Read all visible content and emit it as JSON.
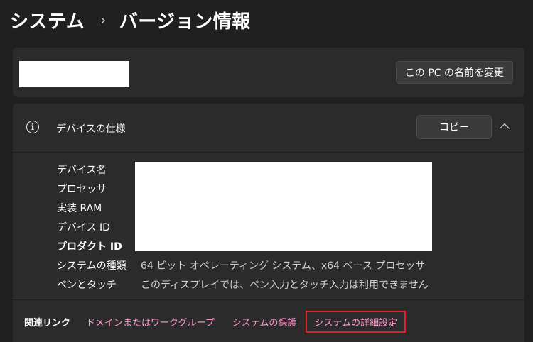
{
  "breadcrumb": {
    "parent": "システム",
    "separator": "›",
    "current": "バージョン情報"
  },
  "name_card": {
    "rename_button": "この PC の名前を変更"
  },
  "device_spec": {
    "title": "デバイスの仕様",
    "copy_button": "コピー",
    "rows": [
      {
        "label": "デバイス名",
        "value": ""
      },
      {
        "label": "プロセッサ",
        "value": ""
      },
      {
        "label": "実装 RAM",
        "value": ""
      },
      {
        "label": "デバイス ID",
        "value": ""
      },
      {
        "label": "プロダクト ID",
        "value": ""
      },
      {
        "label": "システムの種類",
        "value": "64 ビット オペレーティング システム、x64 ベース プロセッサ"
      },
      {
        "label": "ペンとタッチ",
        "value": "このディスプレイでは、ペン入力とタッチ入力は利用できません"
      }
    ]
  },
  "related_links": {
    "label": "関連リンク",
    "links": [
      "ドメインまたはワークグループ",
      "システムの保護",
      "システムの詳細設定"
    ],
    "highlighted": "システムの詳細設定"
  },
  "colors": {
    "background": "#202020",
    "card": "#2b2b2b",
    "link": "#ff99cc",
    "highlight_border": "#e0202a"
  },
  "icons": [
    "info-icon",
    "chevron-up-icon"
  ]
}
